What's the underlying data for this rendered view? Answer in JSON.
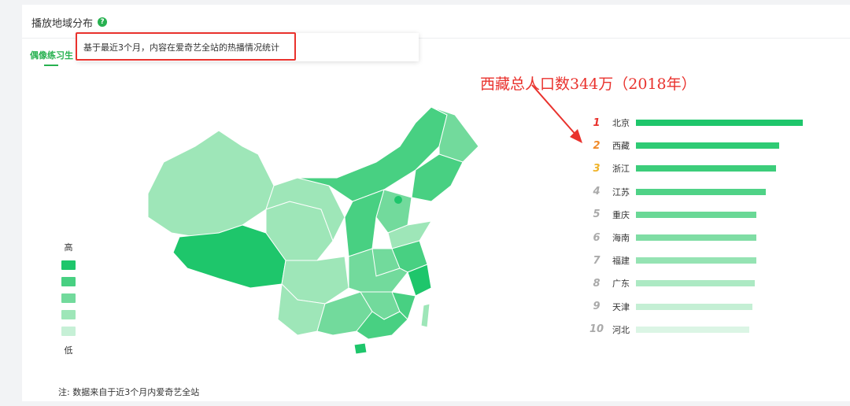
{
  "header": {
    "title": "播放地域分布",
    "help_glyph": "?"
  },
  "tab": {
    "label": "偶像练习生"
  },
  "tooltip": {
    "text": "基于最近3个月，内容在爱奇艺全站的热播情况统计"
  },
  "annotation": {
    "text": "西藏总人口数344万（2018年）"
  },
  "legend": {
    "high": "高",
    "low": "低",
    "colors": [
      "#1ec66b",
      "#48d082",
      "#72da9c",
      "#9ee6b8",
      "#c6f0d6"
    ]
  },
  "ranking": [
    {
      "rank": "1",
      "name": "北京",
      "value": 1.0,
      "num_color": "#e9322d",
      "bar_color": "#1ec66b"
    },
    {
      "rank": "2",
      "name": "西藏",
      "value": 0.86,
      "num_color": "#f08a2a",
      "bar_color": "#2fcb74"
    },
    {
      "rank": "3",
      "name": "浙江",
      "value": 0.84,
      "num_color": "#f0b42a",
      "bar_color": "#3ccd7a"
    },
    {
      "rank": "4",
      "name": "江苏",
      "value": 0.78,
      "num_color": "#aaaaaa",
      "bar_color": "#4fd286"
    },
    {
      "rank": "5",
      "name": "重庆",
      "value": 0.72,
      "num_color": "#aaaaaa",
      "bar_color": "#6ad896"
    },
    {
      "rank": "6",
      "name": "海南",
      "value": 0.72,
      "num_color": "#aaaaaa",
      "bar_color": "#7fdda4"
    },
    {
      "rank": "7",
      "name": "福建",
      "value": 0.72,
      "num_color": "#aaaaaa",
      "bar_color": "#95e3b3"
    },
    {
      "rank": "8",
      "name": "广东",
      "value": 0.71,
      "num_color": "#aaaaaa",
      "bar_color": "#ace9c3"
    },
    {
      "rank": "9",
      "name": "天津",
      "value": 0.7,
      "num_color": "#aaaaaa",
      "bar_color": "#c4efd4"
    },
    {
      "rank": "10",
      "name": "河北",
      "value": 0.68,
      "num_color": "#aaaaaa",
      "bar_color": "#dbf5e5"
    }
  ],
  "footnote": {
    "text": "注: 数据来自于近3个月内爱奇艺全站"
  }
}
